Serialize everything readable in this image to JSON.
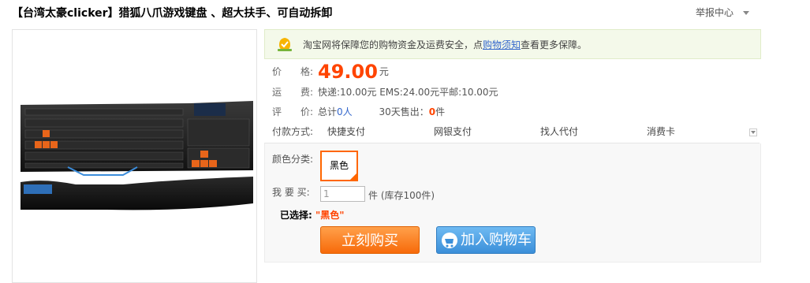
{
  "title": "【台湾太豪clicker】猎狐八爪游戏键盘 、超大扶手、可自动拆卸",
  "report": {
    "label": "举报中心"
  },
  "guarantee": {
    "text": "淘宝网将保障您的购物资金及运费安全，点",
    "link": "购物须知",
    "tail": "查看更多保障。"
  },
  "price": {
    "label": "价　　格:",
    "value": "49.00",
    "unit": "元"
  },
  "shipping": {
    "label": "运　　费:",
    "text": "快递:10.00元 EMS:24.00元平邮:10.00元"
  },
  "review": {
    "label": "评　　价:",
    "total_prefix": "总计",
    "total_count": "0人",
    "sold_prefix": "30天售出：",
    "sold_count": "0",
    "sold_unit": "件"
  },
  "payment": {
    "label": "付款方式:",
    "options": [
      "快捷支付",
      "网银支付",
      "找人代付",
      "消费卡"
    ]
  },
  "sku": {
    "color_label": "颜色分类:",
    "color_value": "黑色",
    "qty_label": "我 要 买:",
    "qty_value": "1",
    "stock_text": "件 (库存100件)",
    "selected_label": "已选择:",
    "selected_value": "\"黑色\""
  },
  "buttons": {
    "buy": "立刻购买",
    "cart": "加入购物车"
  },
  "colors": {
    "accent": "#ff4400",
    "buy": "#f76a0a",
    "cart": "#3b8fd9",
    "guarantee_bg": "#f4f9ea"
  },
  "icons": [
    "shield-hand-icon",
    "chevron-down-icon",
    "cart-icon"
  ]
}
